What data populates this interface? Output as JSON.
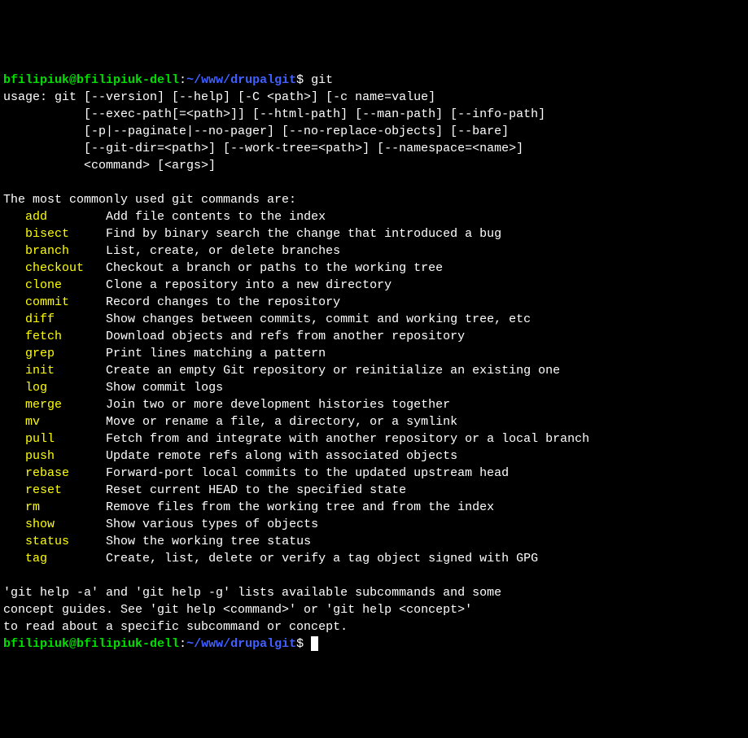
{
  "prompt": {
    "user_host": "bfilipiuk@bfilipiuk-dell",
    "colon": ":",
    "path": "~/www/drupalgit",
    "dollar": "$"
  },
  "command": "git",
  "usage_header": "usage: git [--version] [--help] [-C <path>] [-c name=value]",
  "usage_lines": [
    "           [--exec-path[=<path>]] [--html-path] [--man-path] [--info-path]",
    "           [-p|--paginate|--no-pager] [--no-replace-objects] [--bare]",
    "           [--git-dir=<path>] [--work-tree=<path>] [--namespace=<name>]",
    "           <command> [<args>]"
  ],
  "section_header": "The most commonly used git commands are:",
  "commands": [
    {
      "name": "add",
      "desc": "Add file contents to the index"
    },
    {
      "name": "bisect",
      "desc": "Find by binary search the change that introduced a bug"
    },
    {
      "name": "branch",
      "desc": "List, create, or delete branches"
    },
    {
      "name": "checkout",
      "desc": "Checkout a branch or paths to the working tree"
    },
    {
      "name": "clone",
      "desc": "Clone a repository into a new directory"
    },
    {
      "name": "commit",
      "desc": "Record changes to the repository"
    },
    {
      "name": "diff",
      "desc": "Show changes between commits, commit and working tree, etc"
    },
    {
      "name": "fetch",
      "desc": "Download objects and refs from another repository"
    },
    {
      "name": "grep",
      "desc": "Print lines matching a pattern"
    },
    {
      "name": "init",
      "desc": "Create an empty Git repository or reinitialize an existing one"
    },
    {
      "name": "log",
      "desc": "Show commit logs"
    },
    {
      "name": "merge",
      "desc": "Join two or more development histories together"
    },
    {
      "name": "mv",
      "desc": "Move or rename a file, a directory, or a symlink"
    },
    {
      "name": "pull",
      "desc": "Fetch from and integrate with another repository or a local branch"
    },
    {
      "name": "push",
      "desc": "Update remote refs along with associated objects"
    },
    {
      "name": "rebase",
      "desc": "Forward-port local commits to the updated upstream head"
    },
    {
      "name": "reset",
      "desc": "Reset current HEAD to the specified state"
    },
    {
      "name": "rm",
      "desc": "Remove files from the working tree and from the index"
    },
    {
      "name": "show",
      "desc": "Show various types of objects"
    },
    {
      "name": "status",
      "desc": "Show the working tree status"
    },
    {
      "name": "tag",
      "desc": "Create, list, delete or verify a tag object signed with GPG"
    }
  ],
  "footer_lines": [
    "'git help -a' and 'git help -g' lists available subcommands and some",
    "concept guides. See 'git help <command>' or 'git help <concept>'",
    "to read about a specific subcommand or concept."
  ]
}
